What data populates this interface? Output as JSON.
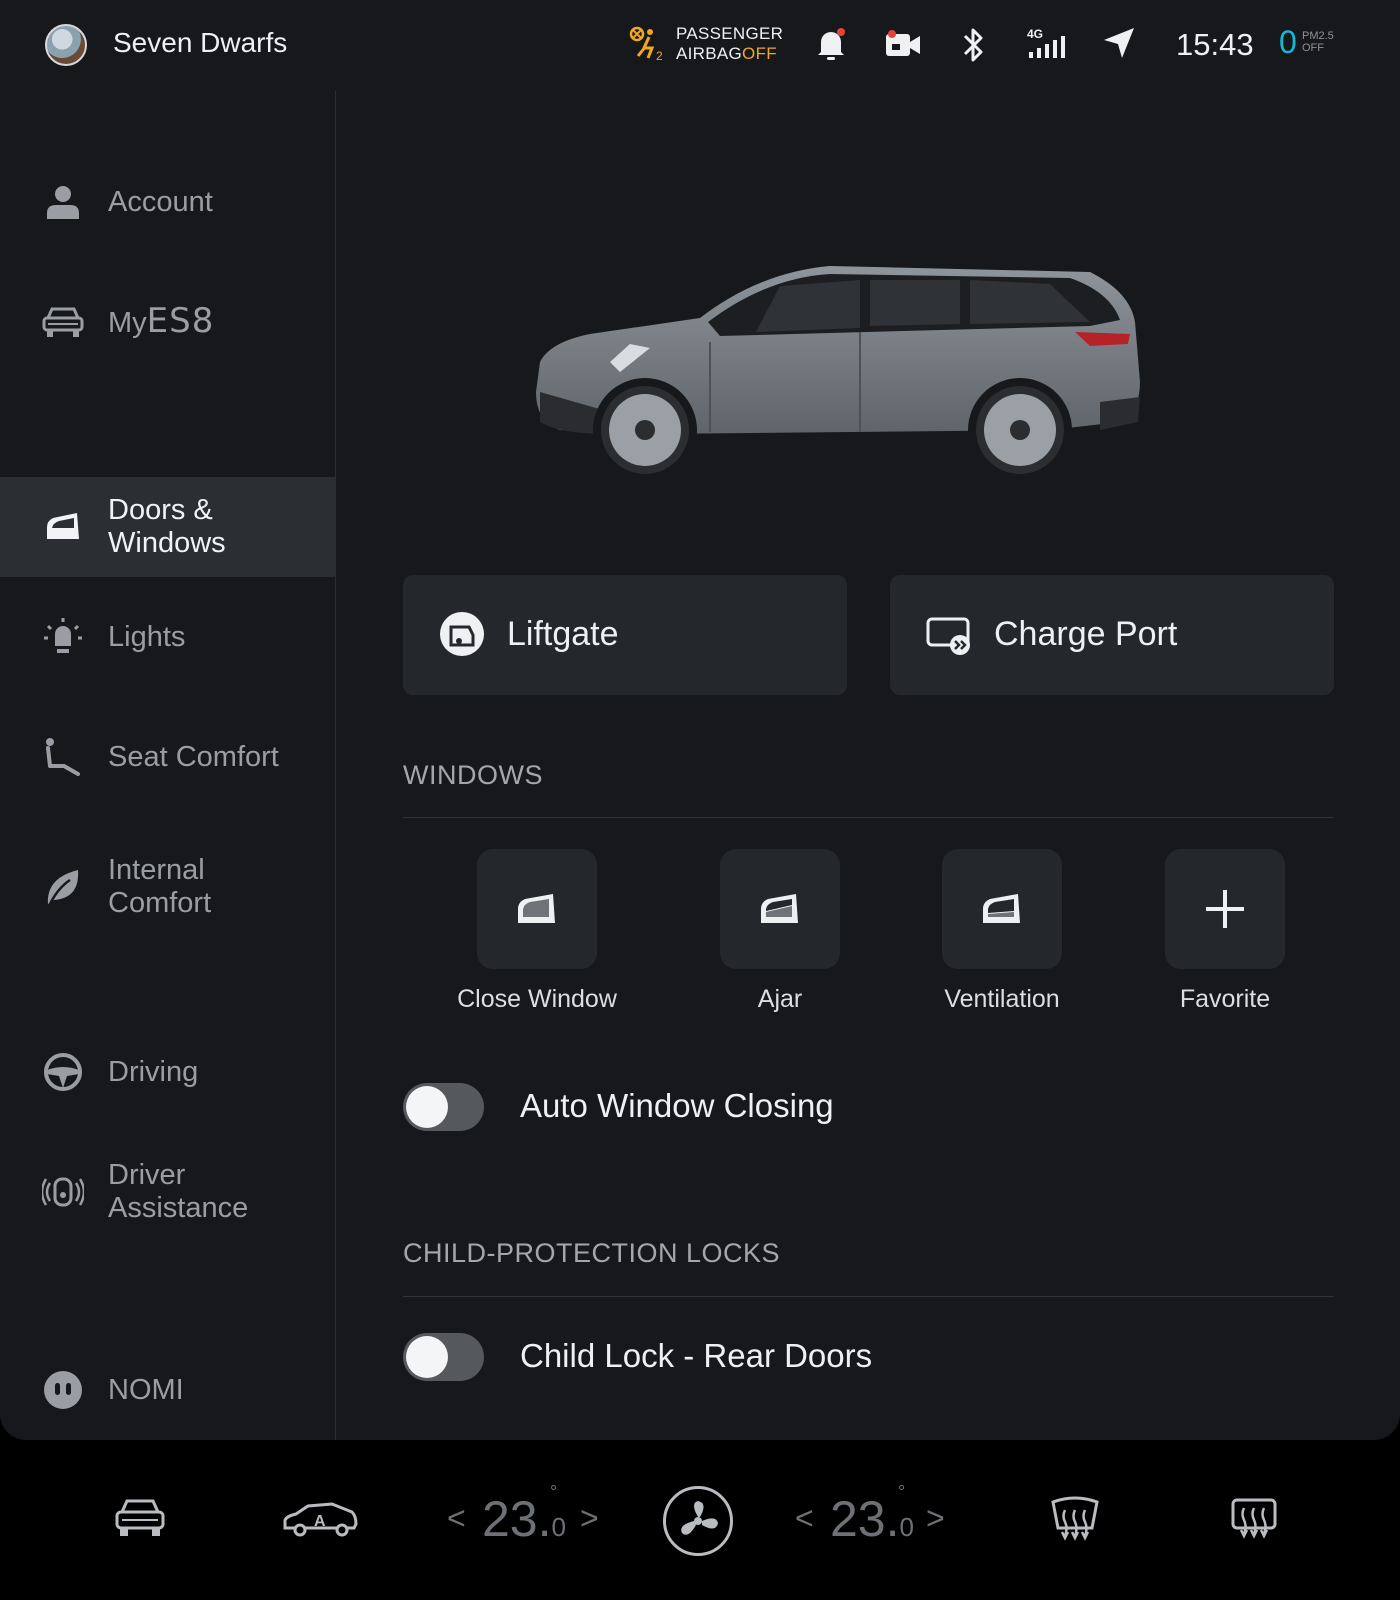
{
  "status_bar": {
    "user_name": "Seven Dwarfs",
    "airbag_line1": "PASSENGER",
    "airbag_line2_prefix": "AIRBAG",
    "airbag_line2_state": "OFF",
    "network": "4G",
    "time": "15:43",
    "pm_value": "0",
    "pm_label": "PM2.5",
    "pm_state": "OFF",
    "colors": {
      "airbag_warning": "#f0a81c",
      "pm_value": "#14b9d6"
    }
  },
  "sidebar": {
    "items": [
      {
        "label": "Account",
        "icon": "person-icon"
      },
      {
        "label": "My",
        "model": "ES8",
        "icon": "car-front-icon"
      },
      {
        "label": "Doors & Windows",
        "icon": "door-icon",
        "active": true
      },
      {
        "label": "Lights",
        "icon": "light-bulb-icon"
      },
      {
        "label": "Seat Comfort",
        "icon": "seat-icon"
      },
      {
        "label": "Internal Comfort",
        "icon": "leaf-icon"
      },
      {
        "label": "Driving",
        "icon": "steering-wheel-icon"
      },
      {
        "label": "Driver Assistance",
        "icon": "driver-assist-icon"
      },
      {
        "label": "NOMI",
        "icon": "nomi-icon"
      }
    ]
  },
  "main": {
    "tiles": [
      {
        "label": "Liftgate",
        "icon": "liftgate-icon"
      },
      {
        "label": "Charge Port",
        "icon": "charge-port-icon"
      }
    ],
    "windows_title": "WINDOWS",
    "window_buttons": [
      {
        "label": "Close Window",
        "icon": "window-closed-icon"
      },
      {
        "label": "Ajar",
        "icon": "window-ajar-icon"
      },
      {
        "label": "Ventilation",
        "icon": "window-vent-icon"
      },
      {
        "label": "Favorite",
        "icon": "plus-icon"
      }
    ],
    "auto_window_closing": {
      "label": "Auto Window Closing",
      "on": false
    },
    "child_locks_title": "CHILD-PROTECTION LOCKS",
    "child_lock_rear": {
      "label": "Child Lock - Rear Doors",
      "on": false
    }
  },
  "dock": {
    "left_temp_int": "23.",
    "left_temp_dec": "0",
    "right_temp_int": "23.",
    "right_temp_dec": "0",
    "degree": "°",
    "auto_label": "A",
    "chev_left": "<",
    "chev_right": ">"
  }
}
